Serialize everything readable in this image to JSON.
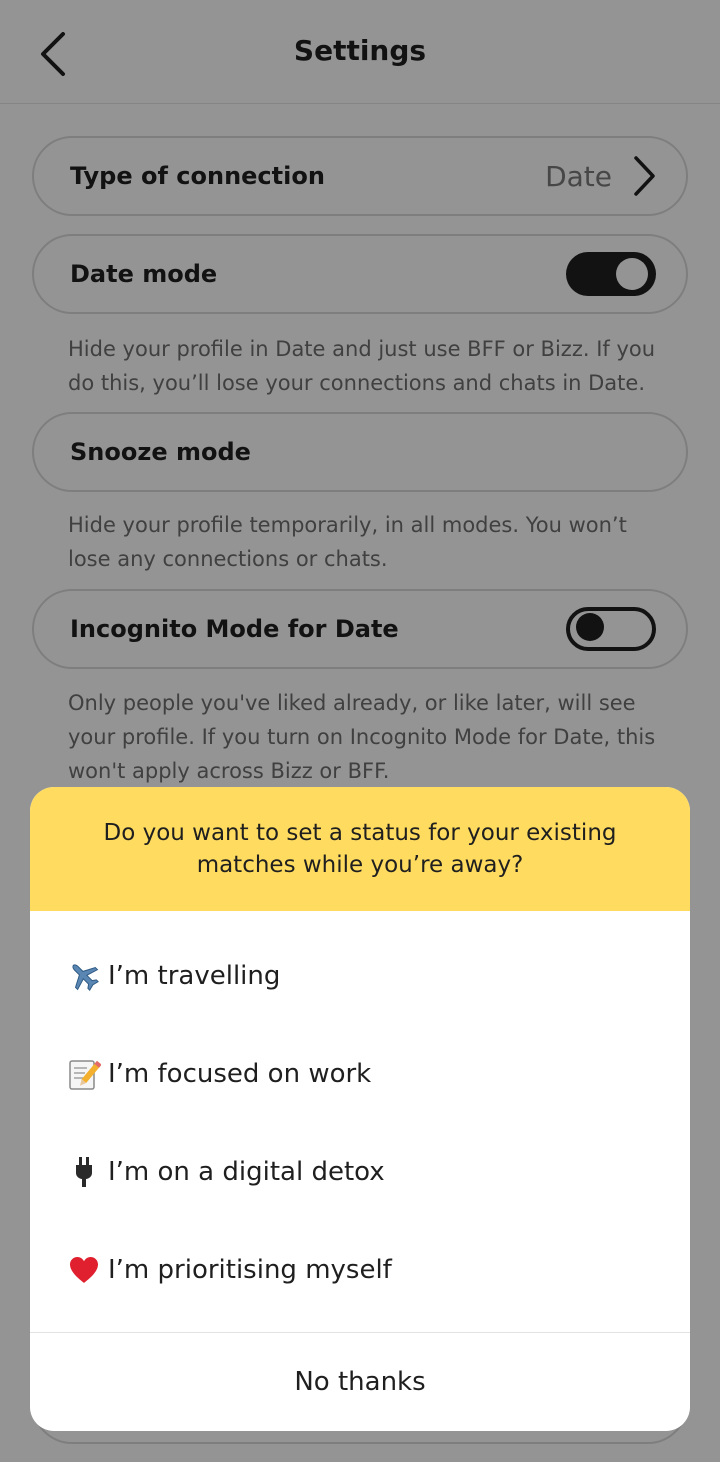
{
  "header": {
    "title": "Settings",
    "back_icon": "chevron-left-icon"
  },
  "settings": {
    "connection": {
      "label": "Type of connection",
      "value": "Date",
      "icon": "chevron-right-icon"
    },
    "date_mode": {
      "label": "Date mode",
      "toggle": "on",
      "description": "Hide your profile in Date and just use BFF or Bizz. If you do this, you’ll lose your connections and chats in Date."
    },
    "snooze_mode": {
      "label": "Snooze mode",
      "description": "Hide your profile temporarily, in all modes. You won’t lose any connections or chats."
    },
    "incognito": {
      "label": "Incognito Mode for Date",
      "toggle": "off",
      "description": "Only people you've liked already, or like later, will see your profile. If you turn on Incognito Mode for Date, this won't apply across Bizz or BFF."
    }
  },
  "dialog": {
    "question": "Do you want to set a status for your existing matches while you’re away?",
    "options": [
      {
        "icon": "airplane-icon",
        "label": "I’m travelling"
      },
      {
        "icon": "memo-icon",
        "label": "I’m focused on work"
      },
      {
        "icon": "plug-icon",
        "label": "I’m on a digital detox"
      },
      {
        "icon": "heart-icon",
        "label": "I’m prioritising myself"
      }
    ],
    "dismiss_label": "No thanks"
  },
  "colors": {
    "accent_yellow": "#ffdc60",
    "text_dark": "#1f1f1f",
    "text_muted": "#6e6e6e",
    "heart_red": "#e0202f"
  }
}
